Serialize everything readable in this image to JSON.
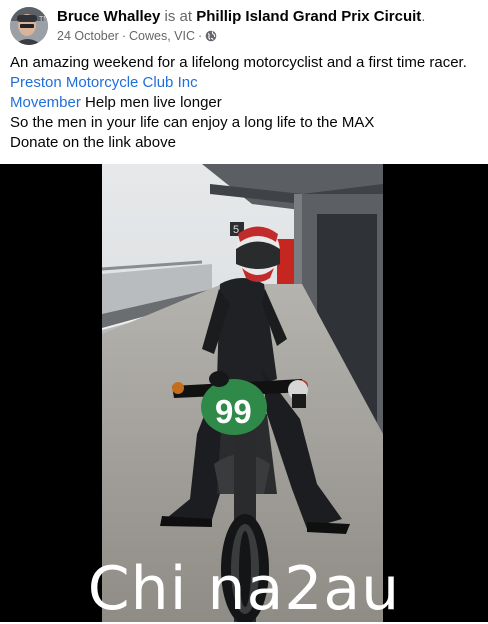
{
  "post": {
    "author": "Bruce Whalley",
    "at_text": "is at",
    "place": "Phillip Island Grand Prix Circuit",
    "period": ".",
    "date": "24 October",
    "separator": "·",
    "location": "Cowes, VIC",
    "separator2": "·",
    "audience_icon": "globe-icon"
  },
  "caption": {
    "line1": "An amazing weekend for a lifelong motorcyclist and a first time racer.",
    "link1": "Preston Motorcycle Club Inc",
    "link2": "Movember",
    "line3_rest": " Help men live longer",
    "line4": "So the men in your life can enjoy a long life to the MAX",
    "line5": "Donate on the link above"
  },
  "media": {
    "number_plate": "99",
    "garage_number": "5",
    "watermark": "Chi na2au"
  },
  "colors": {
    "link": "#216fdb",
    "muted": "#65676b",
    "plate_green": "#2f8a4a"
  }
}
